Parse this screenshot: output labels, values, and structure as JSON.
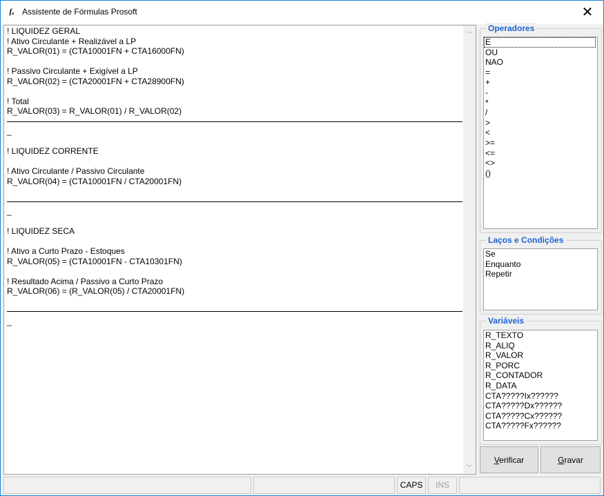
{
  "window": {
    "title": "Assistente de Fórmulas Prosoft",
    "icon_text": "fₐ",
    "close_symbol": "✕"
  },
  "editor": {
    "lines": [
      {
        "kind": "text",
        "text": "! LIQUIDEZ GERAL"
      },
      {
        "kind": "text",
        "text": "! Ativo Circulante + Realizável a LP"
      },
      {
        "kind": "text",
        "text": "R_VALOR(01) = (CTA10001FN + CTA16000FN)"
      },
      {
        "kind": "text",
        "text": ""
      },
      {
        "kind": "text",
        "text": "! Passivo Circulante + Exigível a LP"
      },
      {
        "kind": "text",
        "text": "R_VALOR(02) = (CTA20001FN + CTA28900FN)"
      },
      {
        "kind": "text",
        "text": ""
      },
      {
        "kind": "text",
        "text": "! Total"
      },
      {
        "kind": "text",
        "text": "R_VALOR(03) = R_VALOR(01) / R_VALOR(02)"
      },
      {
        "kind": "rule",
        "text": ""
      },
      {
        "kind": "text",
        "text": "_"
      },
      {
        "kind": "text",
        "text": ""
      },
      {
        "kind": "text",
        "text": "! LIQUIDEZ CORRENTE"
      },
      {
        "kind": "text",
        "text": ""
      },
      {
        "kind": "text",
        "text": "! Ativo Circulante / Passivo Circulante"
      },
      {
        "kind": "text",
        "text": "R_VALOR(04) = (CTA10001FN / CTA20001FN)"
      },
      {
        "kind": "text",
        "text": ""
      },
      {
        "kind": "rule",
        "text": ""
      },
      {
        "kind": "text",
        "text": "_"
      },
      {
        "kind": "text",
        "text": ""
      },
      {
        "kind": "text",
        "text": "! LIQUIDEZ SECA"
      },
      {
        "kind": "text",
        "text": ""
      },
      {
        "kind": "text",
        "text": "! Ativo a Curto Prazo - Estoques"
      },
      {
        "kind": "text",
        "text": "R_VALOR(05) = (CTA10001FN - CTA10301FN)"
      },
      {
        "kind": "text",
        "text": ""
      },
      {
        "kind": "text",
        "text": "! Resultado Acima / Passivo a Curto Prazo"
      },
      {
        "kind": "text",
        "text": "R_VALOR(06) = (R_VALOR(05) / CTA20001FN)"
      },
      {
        "kind": "text",
        "text": ""
      },
      {
        "kind": "rule",
        "text": ""
      },
      {
        "kind": "text",
        "text": "_"
      }
    ],
    "scroll_up": "︿",
    "scroll_down": "﹀"
  },
  "operadores": {
    "label": "Operadores",
    "items": [
      "E",
      "OU",
      "NAO",
      "=",
      "+",
      "-",
      "*",
      "/",
      ">",
      "<",
      ">=",
      "<=",
      "<>",
      "()"
    ],
    "selected_index": 0
  },
  "lacos": {
    "label": "Laços e Condições",
    "items": [
      "Se",
      "Enquanto",
      "Repetir"
    ]
  },
  "variaveis": {
    "label": "Variáveis",
    "items": [
      "R_TEXTO",
      "R_ALIQ",
      "R_VALOR",
      "R_PORC",
      "R_CONTADOR",
      "R_DATA",
      "CTA?????Ix??????",
      "CTA?????Dx??????",
      "CTA?????Cx??????",
      "CTA?????Fx??????"
    ]
  },
  "buttons": {
    "verificar": {
      "accel": "V",
      "rest": "erificar"
    },
    "gravar": {
      "accel": "G",
      "rest": "ravar"
    }
  },
  "statusbar": {
    "panel1": "",
    "panel2": "",
    "caps": "CAPS",
    "ins": "INS",
    "panel5": ""
  },
  "colors": {
    "group_label": "#1d63d2",
    "window_border": "#1883d7",
    "disabled_text": "#a0a0a0"
  }
}
